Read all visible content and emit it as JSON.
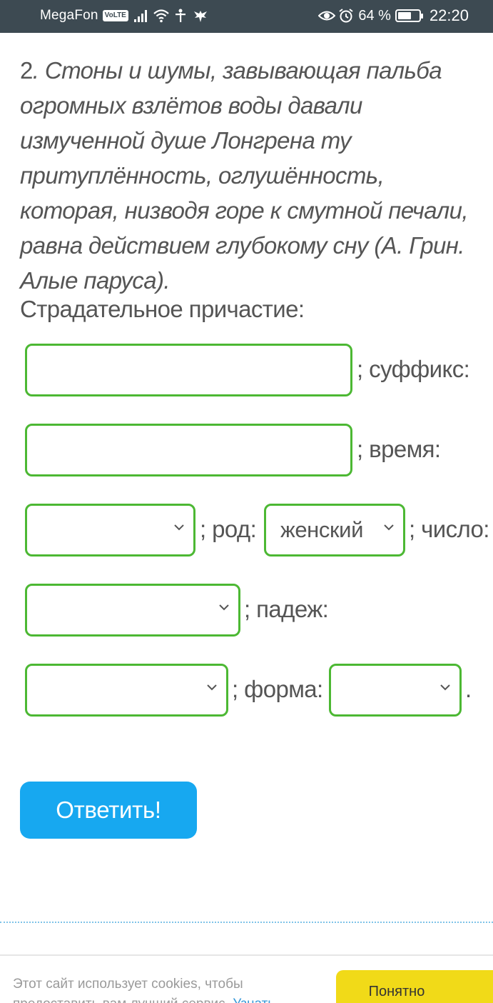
{
  "status_bar": {
    "carrier": "MegaFon",
    "volte": "VoLTE",
    "battery_percent_text": "64 %",
    "battery_level": 0.64,
    "time": "22:20",
    "icons": [
      "signal-icon",
      "wifi-icon",
      "antenna-person-icon",
      "eagle-icon",
      "eye-icon",
      "alarm-icon",
      "battery-icon"
    ]
  },
  "question": {
    "number": "2",
    "text": ". Стоны и шумы, завывающая пальба огромных взлётов воды давали измученной душе Лонгрена ту притуплённость, оглушённость, которая, низводя горе к смутной печали, равна действием глубокому сну (А. Грин. Алые паруса)."
  },
  "form": {
    "participle_label": "Страдательное причастие:",
    "participle_input_value": "",
    "suffix_label": "; суффикс:",
    "suffix_input_value": "",
    "tense_label": "; время:",
    "tense_select_value": "",
    "gender_label": "; род:",
    "gender_select_value": "женский",
    "number_label": "; число:",
    "number_select_value": "",
    "case_label": "; падеж:",
    "case_select_value": "",
    "form_label": "; форма:",
    "form_select_value": "",
    "end_punct": "."
  },
  "buttons": {
    "answer": "Ответить!"
  },
  "cookie_bar": {
    "text": "Этот сайт использует cookies, чтобы предоставить вам лучший сервис.",
    "link": "Узнать",
    "accept": "Понятно"
  },
  "colors": {
    "statusbar_bg": "#3d4a52",
    "field_border": "#4cb833",
    "button_bg": "#17a8f0",
    "cookie_button_bg": "#f1da18"
  }
}
